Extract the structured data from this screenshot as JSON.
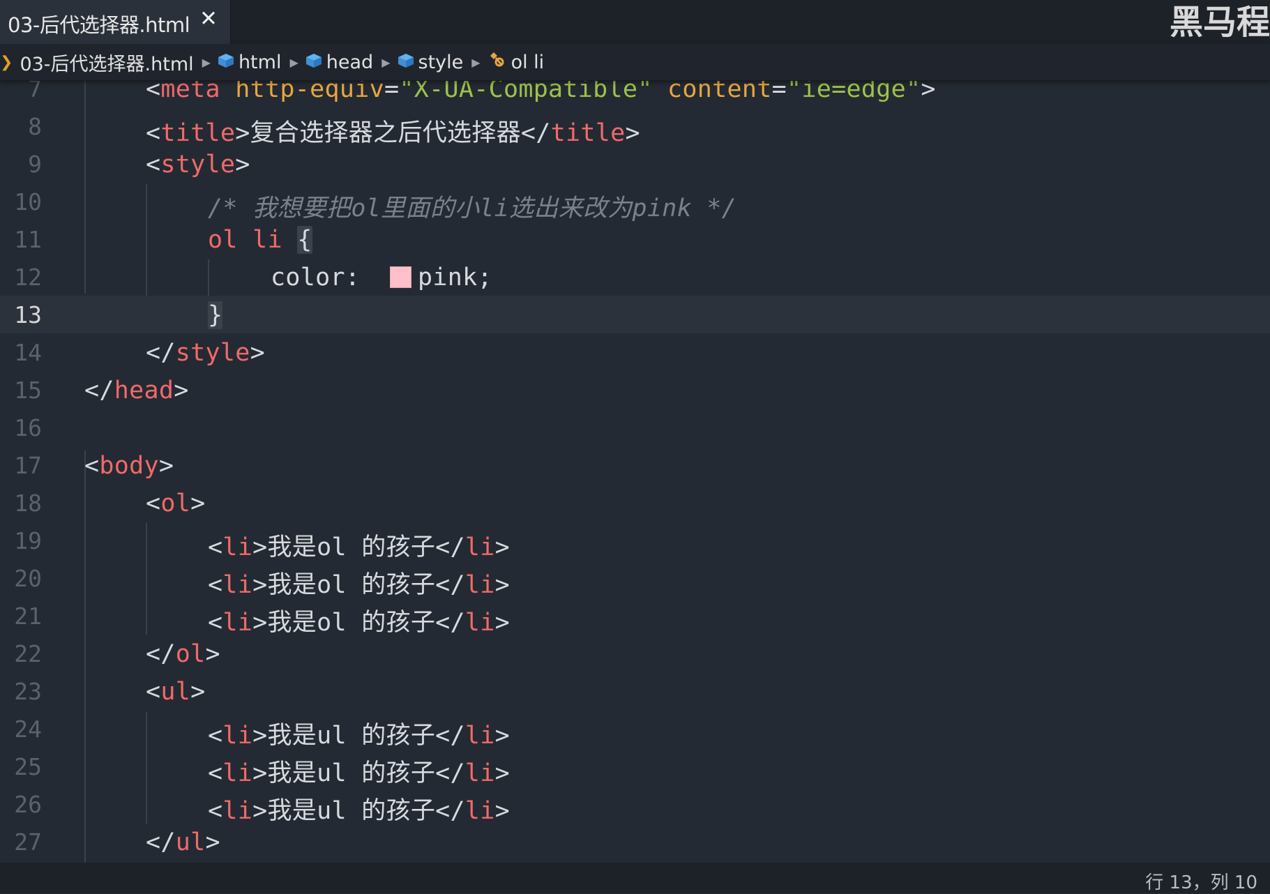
{
  "tab": {
    "title": "03-后代选择器.html",
    "close_label": "✕"
  },
  "watermark": "黑马程",
  "breadcrumb": {
    "items": [
      {
        "label": "03-后代选择器.html",
        "icon": "file"
      },
      {
        "label": "html",
        "icon": "element-cube-icon"
      },
      {
        "label": "head",
        "icon": "element-cube-icon"
      },
      {
        "label": "style",
        "icon": "element-cube-icon"
      },
      {
        "label": "ol li",
        "icon": "css-selector-icon"
      }
    ]
  },
  "editor": {
    "active_line": 13,
    "line_numbers": [
      "7",
      "8",
      "9",
      "10",
      "11",
      "12",
      "13",
      "14",
      "15",
      "16",
      "17",
      "18",
      "19",
      "20",
      "21",
      "22",
      "23",
      "24",
      "25",
      "26",
      "27"
    ],
    "lines": {
      "l7": {
        "lt": "<",
        "tag": "meta",
        "attr1": "http-equiv",
        "eq1": "=",
        "str1": "\"X-UA-Compatible\"",
        "attr2": "content",
        "eq2": "=",
        "str2": "\"ie=edge\"",
        "gt": ">"
      },
      "l8": {
        "lt": "<",
        "tag": "title",
        "gt": ">",
        "text": "复合选择器之后代选择器",
        "close_lt": "</",
        "close_tag": "title",
        "close_gt": ">"
      },
      "l9": {
        "lt": "<",
        "tag": "style",
        "gt": ">"
      },
      "l10": {
        "comment": "/* 我想要把ol里面的小li选出来改为pink */"
      },
      "l11": {
        "selector": "ol li",
        "brace": "{"
      },
      "l12": {
        "property": "color:",
        "value": "pink;",
        "swatch_color": "#ffc0cb"
      },
      "l13": {
        "brace": "}"
      },
      "l14": {
        "lt": "</",
        "tag": "style",
        "gt": ">"
      },
      "l15": {
        "lt": "</",
        "tag": "head",
        "gt": ">"
      },
      "l17": {
        "lt": "<",
        "tag": "body",
        "gt": ">"
      },
      "l18": {
        "lt": "<",
        "tag": "ol",
        "gt": ">"
      },
      "l19": {
        "lt": "<",
        "tag": "li",
        "gt": ">",
        "text": "我是ol 的孩子",
        "close_lt": "</",
        "close_tag": "li",
        "close_gt": ">"
      },
      "l20": {
        "lt": "<",
        "tag": "li",
        "gt": ">",
        "text": "我是ol 的孩子",
        "close_lt": "</",
        "close_tag": "li",
        "close_gt": ">"
      },
      "l21": {
        "lt": "<",
        "tag": "li",
        "gt": ">",
        "text": "我是ol 的孩子",
        "close_lt": "</",
        "close_tag": "li",
        "close_gt": ">"
      },
      "l22": {
        "lt": "</",
        "tag": "ol",
        "gt": ">"
      },
      "l23": {
        "lt": "<",
        "tag": "ul",
        "gt": ">"
      },
      "l24": {
        "lt": "<",
        "tag": "li",
        "gt": ">",
        "text": "我是ul 的孩子",
        "close_lt": "</",
        "close_tag": "li",
        "close_gt": ">"
      },
      "l25": {
        "lt": "<",
        "tag": "li",
        "gt": ">",
        "text": "我是ul 的孩子",
        "close_lt": "</",
        "close_tag": "li",
        "close_gt": ">"
      },
      "l26": {
        "lt": "<",
        "tag": "li",
        "gt": ">",
        "text": "我是ul 的孩子",
        "close_lt": "</",
        "close_tag": "li",
        "close_gt": ">"
      },
      "l27": {
        "lt": "</",
        "tag": "ul",
        "gt": ">"
      }
    }
  },
  "status": {
    "cursor": "行 13，列 10"
  },
  "colors": {
    "background": "#242a33",
    "tag": "#f06a6a",
    "attribute": "#e8a640",
    "string": "#9ec24a",
    "comment": "#7a818b",
    "swatch_pink": "#ffc0cb"
  }
}
